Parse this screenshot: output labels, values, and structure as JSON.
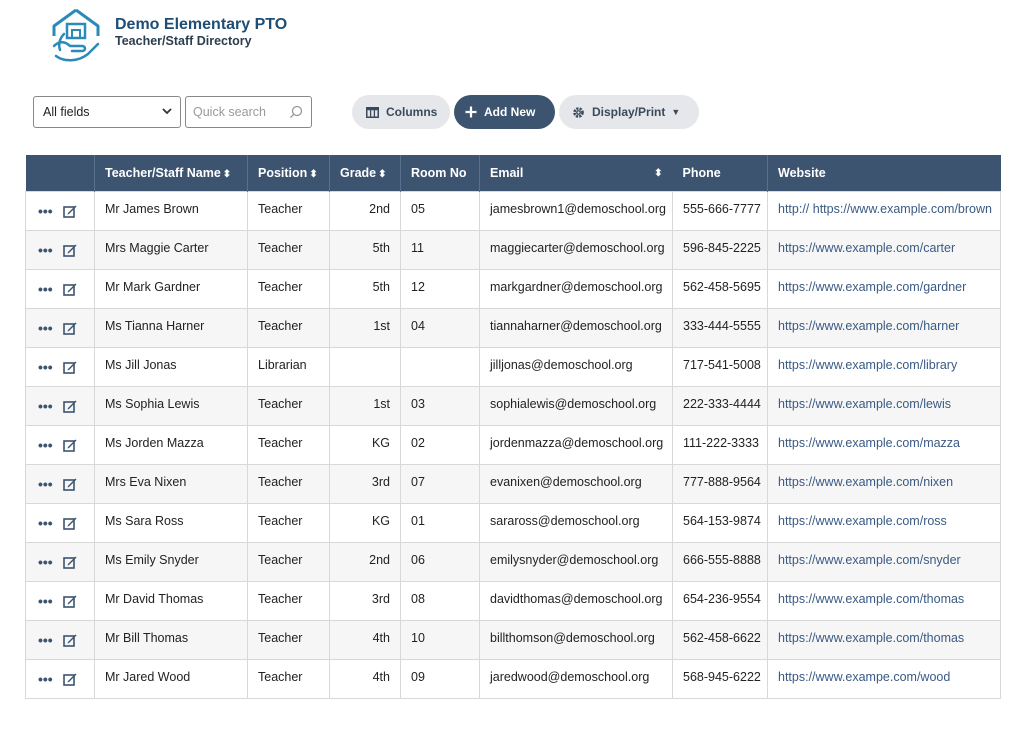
{
  "header": {
    "org_title": "Demo Elementary PTO",
    "sub_title": "Teacher/Staff Directory"
  },
  "toolbar": {
    "field_select": "All fields",
    "search_placeholder": "Quick search",
    "columns_label": "Columns",
    "add_new_label": "Add New",
    "display_print_label": "Display/Print"
  },
  "colors": {
    "header_bg": "#3d5470",
    "link": "#3a5a84",
    "title": "#1f4d73"
  },
  "table": {
    "columns": [
      "Teacher/Staff Name",
      "Position",
      "Grade",
      "Room No",
      "Email",
      "Phone",
      "Website"
    ],
    "sort_icon": "⬍",
    "rows": [
      {
        "name": "Mr James Brown",
        "position": "Teacher",
        "grade": "2nd",
        "room": "05",
        "email": "jamesbrown1@demoschool.org",
        "phone": "555-666-7777",
        "website": "http:// https://www.example.com/brown"
      },
      {
        "name": "Mrs Maggie Carter",
        "position": "Teacher",
        "grade": "5th",
        "room": "11",
        "email": "maggiecarter@demoschool.org",
        "phone": "596-845-2225",
        "website": "https://www.example.com/carter"
      },
      {
        "name": "Mr Mark Gardner",
        "position": "Teacher",
        "grade": "5th",
        "room": "12",
        "email": "markgardner@demoschool.org",
        "phone": "562-458-5695",
        "website": "https://www.example.com/gardner"
      },
      {
        "name": "Ms Tianna Harner",
        "position": "Teacher",
        "grade": "1st",
        "room": "04",
        "email": "tiannaharner@demoschool.org",
        "phone": "333-444-5555",
        "website": "https://www.example.com/harner"
      },
      {
        "name": "Ms Jill Jonas",
        "position": "Librarian",
        "grade": "",
        "room": "",
        "email": "jilljonas@demoschool.org",
        "phone": "717-541-5008",
        "website": "https://www.example.com/library"
      },
      {
        "name": "Ms Sophia Lewis",
        "position": "Teacher",
        "grade": "1st",
        "room": "03",
        "email": "sophialewis@demoschool.org",
        "phone": "222-333-4444",
        "website": "https://www.example.com/lewis"
      },
      {
        "name": "Ms Jorden Mazza",
        "position": "Teacher",
        "grade": "KG",
        "room": "02",
        "email": "jordenmazza@demoschool.org",
        "phone": "111-222-3333",
        "website": "https://www.example.com/mazza"
      },
      {
        "name": "Mrs Eva Nixen",
        "position": "Teacher",
        "grade": "3rd",
        "room": "07",
        "email": "evanixen@demoschool.org",
        "phone": "777-888-9564",
        "website": "https://www.example.com/nixen"
      },
      {
        "name": "Ms Sara Ross",
        "position": "Teacher",
        "grade": "KG",
        "room": "01",
        "email": "saraross@demoschool.org",
        "phone": "564-153-9874",
        "website": "https://www.example.com/ross"
      },
      {
        "name": "Ms Emily Snyder",
        "position": "Teacher",
        "grade": "2nd",
        "room": "06",
        "email": "emilysnyder@demoschool.org",
        "phone": "666-555-8888",
        "website": "https://www.example.com/snyder"
      },
      {
        "name": "Mr David Thomas",
        "position": "Teacher",
        "grade": "3rd",
        "room": "08",
        "email": "davidthomas@demoschool.org",
        "phone": "654-236-9554",
        "website": "https://www.example.com/thomas"
      },
      {
        "name": "Mr Bill Thomas",
        "position": "Teacher",
        "grade": "4th",
        "room": "10",
        "email": "billthomson@demoschool.org",
        "phone": "562-458-6622",
        "website": "https://www.example.com/thomas"
      },
      {
        "name": "Mr Jared Wood",
        "position": "Teacher",
        "grade": "4th",
        "room": "09",
        "email": "jaredwood@demoschool.org",
        "phone": "568-945-6222",
        "website": "https://www.exampe.com/wood"
      }
    ]
  }
}
